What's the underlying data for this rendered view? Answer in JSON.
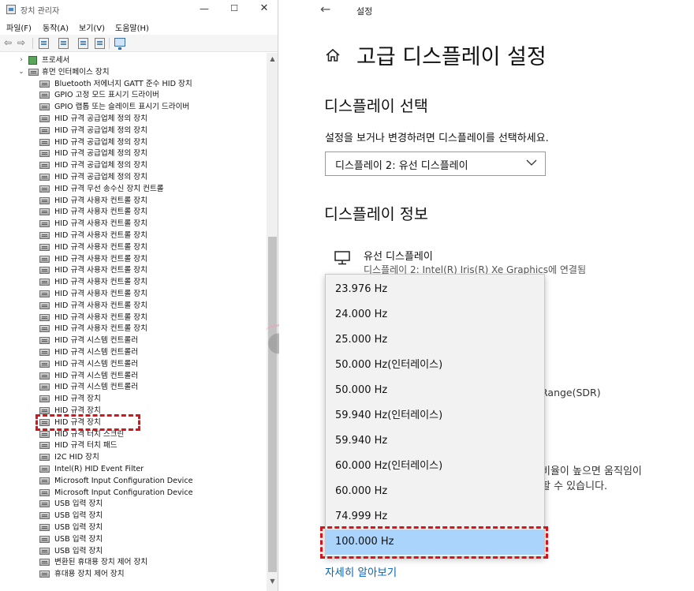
{
  "device_manager": {
    "title": "장치 관리자",
    "window_buttons": {
      "minimize": "—",
      "maximize": "☐",
      "close": "✕"
    },
    "menu": [
      "파일(F)",
      "동작(A)",
      "보기(V)",
      "도움말(H)"
    ],
    "toolbar_glyphs": {
      "back": "⇦",
      "forward": "⇨"
    },
    "tree": [
      {
        "label": "프로세서",
        "twisty": "›",
        "level": 0,
        "icon": "processor-icon"
      },
      {
        "label": "휴먼 인터페이스 장치",
        "twisty": "⌄",
        "level": 0,
        "icon": "hid-category-icon"
      },
      {
        "label": "Bluetooth 저에너지 GATT 준수 HID 장치",
        "level": 1
      },
      {
        "label": "GPIO 고정 모드 표시기 드라이버",
        "level": 1
      },
      {
        "label": "GPIO 랩톱 또는 슬레이트 표시기 드라이버",
        "level": 1
      },
      {
        "label": "HID 규격 공급업체 정의 장치",
        "level": 1
      },
      {
        "label": "HID 규격 공급업체 정의 장치",
        "level": 1
      },
      {
        "label": "HID 규격 공급업체 정의 장치",
        "level": 1
      },
      {
        "label": "HID 규격 공급업체 정의 장치",
        "level": 1
      },
      {
        "label": "HID 규격 공급업체 정의 장치",
        "level": 1
      },
      {
        "label": "HID 규격 공급업체 정의 장치",
        "level": 1
      },
      {
        "label": "HID 규격 무선 송수신 장치 컨트롤",
        "level": 1
      },
      {
        "label": "HID 규격 사용자 컨트롤 장치",
        "level": 1
      },
      {
        "label": "HID 규격 사용자 컨트롤 장치",
        "level": 1
      },
      {
        "label": "HID 규격 사용자 컨트롤 장치",
        "level": 1
      },
      {
        "label": "HID 규격 사용자 컨트롤 장치",
        "level": 1
      },
      {
        "label": "HID 규격 사용자 컨트롤 장치",
        "level": 1
      },
      {
        "label": "HID 규격 사용자 컨트롤 장치",
        "level": 1
      },
      {
        "label": "HID 규격 사용자 컨트롤 장치",
        "level": 1
      },
      {
        "label": "HID 규격 사용자 컨트롤 장치",
        "level": 1
      },
      {
        "label": "HID 규격 사용자 컨트롤 장치",
        "level": 1
      },
      {
        "label": "HID 규격 사용자 컨트롤 장치",
        "level": 1
      },
      {
        "label": "HID 규격 사용자 컨트롤 장치",
        "level": 1
      },
      {
        "label": "HID 규격 사용자 컨트롤 장치",
        "level": 1
      },
      {
        "label": "HID 규격 시스템 컨트롤러",
        "level": 1
      },
      {
        "label": "HID 규격 시스템 컨트롤러",
        "level": 1
      },
      {
        "label": "HID 규격 시스템 컨트롤러",
        "level": 1
      },
      {
        "label": "HID 규격 시스템 컨트롤러",
        "level": 1
      },
      {
        "label": "HID 규격 시스템 컨트롤러",
        "level": 1
      },
      {
        "label": "HID 규격 장치",
        "level": 1
      },
      {
        "label": "HID 규격 장치",
        "level": 1
      },
      {
        "label": "HID 규격 장치",
        "level": 1
      },
      {
        "label": "HID 규격 터치 스크린",
        "level": 1
      },
      {
        "label": "HID 규격 터치 패드",
        "level": 1
      },
      {
        "label": "I2C HID 장치",
        "level": 1
      },
      {
        "label": "Intel(R) HID Event Filter",
        "level": 1
      },
      {
        "label": "Microsoft Input Configuration Device",
        "level": 1
      },
      {
        "label": "Microsoft Input Configuration Device",
        "level": 1
      },
      {
        "label": "USB 입력 장치",
        "level": 1
      },
      {
        "label": "USB 입력 장치",
        "level": 1
      },
      {
        "label": "USB 입력 장치",
        "level": 1
      },
      {
        "label": "USB 입력 장치",
        "level": 1
      },
      {
        "label": "USB 입력 장치",
        "level": 1
      },
      {
        "label": "변환된 휴대용 장치 제어 장치",
        "level": 1
      },
      {
        "label": "휴대용 장치 제어 장치",
        "level": 1
      }
    ],
    "highlighted_item": "HID 규격 터치 스크린",
    "scrollbar": {
      "up": "▲",
      "down": "▼"
    },
    "accent_color": "#d9131a"
  },
  "settings": {
    "back_glyph": "←",
    "title": "설정",
    "heading": "고급 디스플레이 설정",
    "section_select_display": "디스플레이 선택",
    "instruction": "설정을 보거나 변경하려면 디스플레이를 선택하세요.",
    "display_select_value": "디스플레이 2: 유선 디스플레이",
    "section_display_info": "디스플레이 정보",
    "monitor_name": "유선 디스플레이",
    "monitor_subtitle": "디스플레이 2: Intel(R) Iris(R) Xe Graphics에 연결됨",
    "partial_texts": [
      "Range(SDR)",
      "비율이 높으면 움직임이",
      "할 수 있습니다."
    ],
    "refresh_rates": [
      "23.976 Hz",
      "24.000 Hz",
      "25.000 Hz",
      "50.000 Hz(인터레이스)",
      "50.000 Hz",
      "59.940 Hz(인터레이스)",
      "59.940 Hz",
      "60.000 Hz(인터레이스)",
      "60.000 Hz",
      "74.999 Hz",
      "100.000 Hz"
    ],
    "selected_refresh_rate": "100.000 Hz",
    "learn_more_link": "자세히 알아보기",
    "link_color": "#0a64b4",
    "selection_color": "#aad4fb"
  }
}
